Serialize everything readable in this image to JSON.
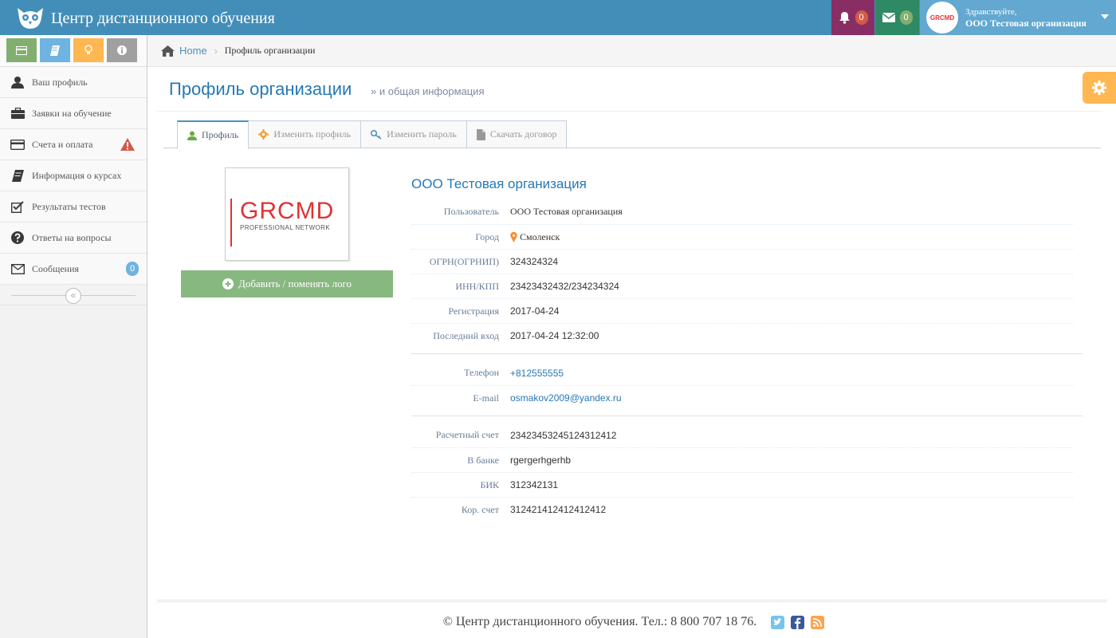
{
  "app": {
    "title": "Центр дистанционного обучения"
  },
  "navbar": {
    "notifications_count": "0",
    "messages_count": "0",
    "greeting": "Здравствуйте,",
    "user_name": "ООО Тестовая организация",
    "avatar_text": "GRCMD"
  },
  "shortcuts": [
    {
      "icon": "credit-card-icon",
      "color": "#82af6f"
    },
    {
      "icon": "book-icon",
      "color": "#6fb3e0"
    },
    {
      "icon": "lightbulb-icon",
      "color": "#ffb752"
    },
    {
      "icon": "info-icon",
      "color": "#a0a0a0"
    }
  ],
  "sidebar": {
    "items": [
      {
        "label": "Ваш профиль",
        "icon": "user-icon"
      },
      {
        "label": "Заявки на обучение",
        "icon": "briefcase-icon"
      },
      {
        "label": "Счета и оплата",
        "icon": "credit-card-icon"
      },
      {
        "label": "Информация о курсах",
        "icon": "book-icon"
      },
      {
        "label": "Результаты тестов",
        "icon": "checkbox-icon"
      },
      {
        "label": "Ответы на вопросы",
        "icon": "question-icon"
      },
      {
        "label": "Сообщения",
        "icon": "envelope-icon",
        "badge": "0"
      }
    ]
  },
  "breadcrumb": {
    "home": "Home",
    "current": "Профиль организации"
  },
  "page": {
    "title": "Профиль организации",
    "subtitle": "» и общая информация"
  },
  "tabs": [
    {
      "label": "Профиль",
      "active": true
    },
    {
      "label": "Изменить профиль"
    },
    {
      "label": "Изменить пароль"
    },
    {
      "label": "Скачать договор"
    }
  ],
  "logo": {
    "word": "GRCMD",
    "sub": "PROFESSIONAL NETWORK",
    "button": "Добавить / поменять лого"
  },
  "profile": {
    "org_name": "ООО Тестовая организация",
    "fields": [
      {
        "label": "Пользователь",
        "value": "ООО Тестовая организация"
      },
      {
        "label": "Город",
        "value": "Смоленск"
      },
      {
        "label": "ОГРН(ОГРНИП)",
        "value": "324324324"
      },
      {
        "label": "ИНН/КПП",
        "value": "23423432432/234234324"
      },
      {
        "label": "Регистрация",
        "value": "2017-04-24"
      },
      {
        "label": "Последний вход",
        "value": "2017-04-24 12:32:00"
      }
    ],
    "contacts": [
      {
        "label": "Телефон",
        "value": "+812555555"
      },
      {
        "label": "E-mail",
        "value": "osmakov2009@yandex.ru"
      }
    ],
    "bank": [
      {
        "label": "Расчетный счет",
        "value": "23423453245124312412"
      },
      {
        "label": "В банке",
        "value": "rgergerhgerhb"
      },
      {
        "label": "БИК",
        "value": "312342131"
      },
      {
        "label": "Кор. счет",
        "value": "312421412412412412"
      }
    ]
  },
  "footer": {
    "text": "© Центр дистанционного обучения. Тел.: 8 800 707 18 76."
  }
}
